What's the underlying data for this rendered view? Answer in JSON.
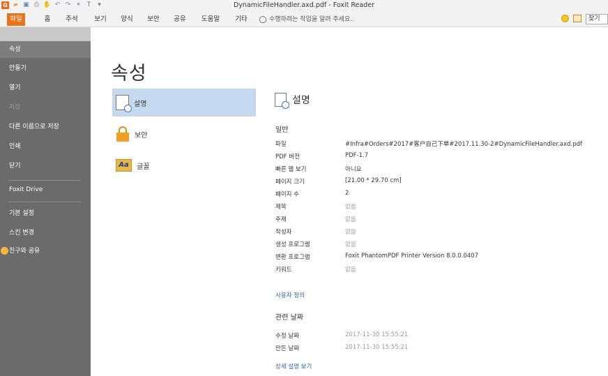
{
  "window": {
    "title": "DynamicFileHandler.axd.pdf - Foxit Reader"
  },
  "quick_access": {
    "icons": [
      "app-logo-icon",
      "open-icon",
      "save-icon",
      "print-icon",
      "hand-icon",
      "undo-icon",
      "redo-icon",
      "select-icon",
      "typewriter-icon",
      "customize-icon"
    ],
    "glyphs": [
      "G",
      "▰",
      "▣",
      "⎙",
      "✋",
      "↶",
      "↷",
      "⌖",
      "T",
      "▾"
    ]
  },
  "ribbon": {
    "tabs": [
      "파일",
      "홈",
      "주석",
      "보기",
      "양식",
      "보안",
      "공유",
      "도움말",
      "기타"
    ],
    "active_tab": "파일",
    "tell_me": "수행하려는 작업을 알려 주세요..",
    "search_placeholder": "찾기"
  },
  "nav": {
    "items": [
      {
        "label": "속성",
        "selected": true
      },
      {
        "label": "만들기"
      },
      {
        "label": "열기"
      },
      {
        "label": "저장",
        "disabled": true
      },
      {
        "label": "다른 이름으로 저장"
      },
      {
        "label": "인쇄"
      },
      {
        "label": "닫기"
      },
      {
        "label": "Foxit Drive"
      },
      {
        "label": "기본 설정"
      },
      {
        "label": "스킨 변경"
      },
      {
        "label": "친구와 공유"
      }
    ]
  },
  "page": {
    "title": "속성"
  },
  "subnav": [
    {
      "label": "설명",
      "icon": "document-info-icon",
      "selected": true
    },
    {
      "label": "보안",
      "icon": "lock-icon"
    },
    {
      "label": "글꼴",
      "icon": "font-icon",
      "glyph": "Aa"
    }
  ],
  "detail": {
    "title": "설명",
    "general_header": "일반",
    "fields": [
      {
        "label": "파일",
        "value": "#Infra#Orders#2017#客户自己下单#2017.11.30-2#DynamicFileHandler.axd.pdf"
      },
      {
        "label": "PDF 버전",
        "value": "PDF-1.7"
      },
      {
        "label": "빠른 웹 보기",
        "value": "아니요"
      },
      {
        "label": "페이지 크기",
        "value": "[21.00 * 29.70 cm]"
      },
      {
        "label": "페이지 수",
        "value": "2"
      },
      {
        "label": "제목",
        "value": "없음",
        "empty": true
      },
      {
        "label": "주제",
        "value": "없음",
        "empty": true
      },
      {
        "label": "작성자",
        "value": "없음",
        "empty": true
      },
      {
        "label": "생성 프로그램",
        "value": "없음",
        "empty": true
      },
      {
        "label": "변환 프로그램",
        "value": "Foxit PhantomPDF Printer Version 8.0.0.0407"
      },
      {
        "label": "키워드",
        "value": "없음",
        "empty": true
      }
    ],
    "custom_link": "사용자 정의",
    "dates_header": "관련 날짜",
    "dates": [
      {
        "label": "수정 날짜",
        "value": "2017-11-30 15:55:21"
      },
      {
        "label": "만든 날짜",
        "value": "2017-11-30 15:55:21"
      }
    ],
    "more_link": "상세 설명 보기"
  }
}
